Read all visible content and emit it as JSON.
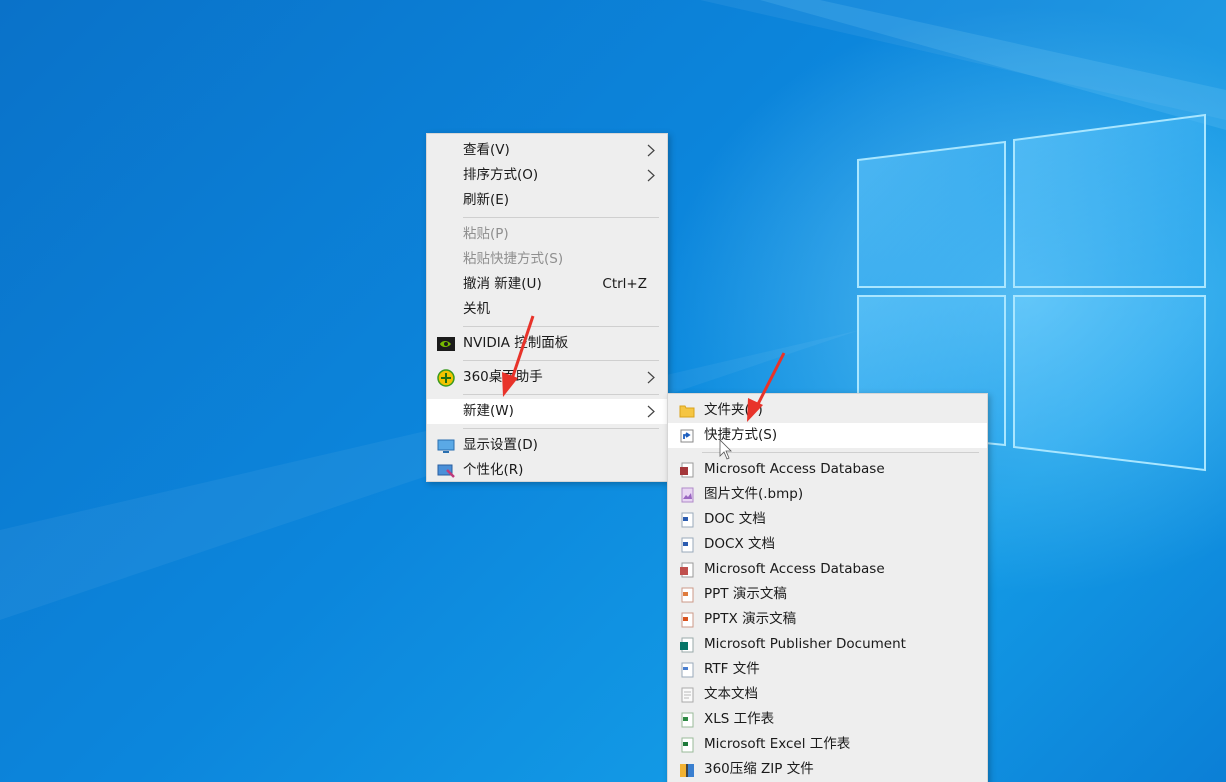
{
  "context_menu": {
    "items": [
      {
        "label": "查看(V)",
        "submenu": true
      },
      {
        "label": "排序方式(O)",
        "submenu": true
      },
      {
        "label": "刷新(E)"
      },
      {
        "label": "粘贴(P)",
        "disabled": true
      },
      {
        "label": "粘贴快捷方式(S)",
        "disabled": true
      },
      {
        "label": "撤消 新建(U)",
        "shortcut": "Ctrl+Z"
      },
      {
        "label": "关机"
      },
      {
        "label": "NVIDIA 控制面板",
        "icon": "nvidia-icon"
      },
      {
        "label": "360桌面助手",
        "icon": "360-desktop-icon",
        "submenu": true
      },
      {
        "label": "新建(W)",
        "submenu": true,
        "highlighted": true
      },
      {
        "label": "显示设置(D)",
        "icon": "display-settings-icon"
      },
      {
        "label": "个性化(R)",
        "icon": "personalize-icon"
      }
    ]
  },
  "new_submenu": {
    "items": [
      {
        "label": "文件夹(F)",
        "icon": "folder-icon"
      },
      {
        "label": "快捷方式(S)",
        "icon": "shortcut-icon",
        "highlighted": true
      },
      {
        "label": "Microsoft Access Database",
        "icon": "access-icon"
      },
      {
        "label": "图片文件(.bmp)",
        "icon": "bmp-icon"
      },
      {
        "label": "DOC 文档",
        "icon": "doc-icon"
      },
      {
        "label": "DOCX 文档",
        "icon": "docx-icon"
      },
      {
        "label": "Microsoft Access Database",
        "icon": "access-icon"
      },
      {
        "label": "PPT 演示文稿",
        "icon": "ppt-icon"
      },
      {
        "label": "PPTX 演示文稿",
        "icon": "pptx-icon"
      },
      {
        "label": "Microsoft Publisher Document",
        "icon": "publisher-icon"
      },
      {
        "label": "RTF 文件",
        "icon": "rtf-icon"
      },
      {
        "label": "文本文档",
        "icon": "text-document-icon"
      },
      {
        "label": "XLS 工作表",
        "icon": "xls-icon"
      },
      {
        "label": "Microsoft Excel 工作表",
        "icon": "excel-icon"
      },
      {
        "label": "360压缩 ZIP 文件",
        "icon": "zip-icon"
      }
    ]
  },
  "colors": {
    "desktop_blue": "#0c86dc",
    "menu_bg": "#eeeeee",
    "highlight_bg": "#ffffff",
    "annotation_arrow": "#e8332a"
  }
}
